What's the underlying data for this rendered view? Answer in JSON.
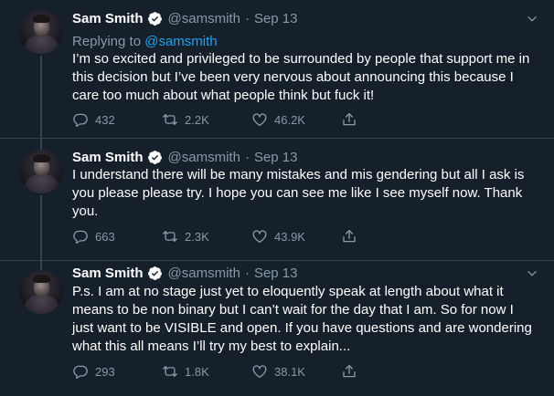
{
  "tweets": [
    {
      "author": "Sam Smith",
      "handle": "@samsmith",
      "separator": "·",
      "date": "Sep 13",
      "replying_prefix": "Replying to ",
      "replying_mention": "@samsmith",
      "text": "I’m so excited and privileged to be surrounded by people that support me in this decision but I’ve been very nervous about announcing this because I care too much about what people think but fuck it!",
      "replies": "432",
      "retweets": "2.2K",
      "likes": "46.2K"
    },
    {
      "author": "Sam Smith",
      "handle": "@samsmith",
      "separator": "·",
      "date": "Sep 13",
      "text": "I understand there will be many mistakes and mis gendering but all I ask is you please please try. I hope you can see me like I see myself now. Thank you.",
      "replies": "663",
      "retweets": "2.3K",
      "likes": "43.9K"
    },
    {
      "author": "Sam Smith",
      "handle": "@samsmith",
      "separator": "·",
      "date": "Sep 13",
      "text": "P.s. I am at no stage just yet to eloquently speak at length about what it means to be non binary but I can’t wait for the day that I am. So for now I just want to be VISIBLE and open. If you have questions and are wondering what this all means I’ll try my best to explain...",
      "replies": "293",
      "retweets": "1.8K",
      "likes": "38.1K"
    }
  ],
  "icons": {
    "verified": "verified-badge-icon",
    "reply": "reply-icon",
    "retweet": "retweet-icon",
    "like": "heart-icon",
    "share": "share-icon",
    "menu": "chevron-down-icon"
  },
  "colors": {
    "background": "#15202b",
    "text": "#ffffff",
    "secondary": "#8899a6",
    "accent": "#1da1f2",
    "border": "#38444d"
  }
}
